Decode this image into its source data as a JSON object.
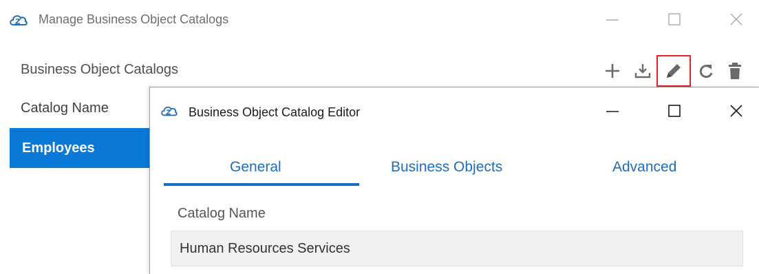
{
  "window": {
    "title": "Manage Business Object Catalogs",
    "icon": "cloud-icon"
  },
  "panel": {
    "heading": "Business Object Catalogs",
    "column_header": "Catalog Name",
    "rows": [
      {
        "label": "Employees",
        "selected": true
      }
    ],
    "toolbar": {
      "actions": [
        "add",
        "import",
        "edit",
        "refresh",
        "delete"
      ],
      "highlighted": "edit"
    }
  },
  "dialog": {
    "title": "Business Object Catalog Editor",
    "tabs": [
      {
        "label": "General",
        "active": true
      },
      {
        "label": "Business Objects",
        "active": false
      },
      {
        "label": "Advanced",
        "active": false
      }
    ],
    "field_label": "Catalog Name",
    "field_value": "Human Resources Services"
  },
  "colors": {
    "accent": "#1d6cbf",
    "selection": "#0a78d7",
    "highlight_border": "#e8202a",
    "icon_gray": "#6a6a6a"
  }
}
